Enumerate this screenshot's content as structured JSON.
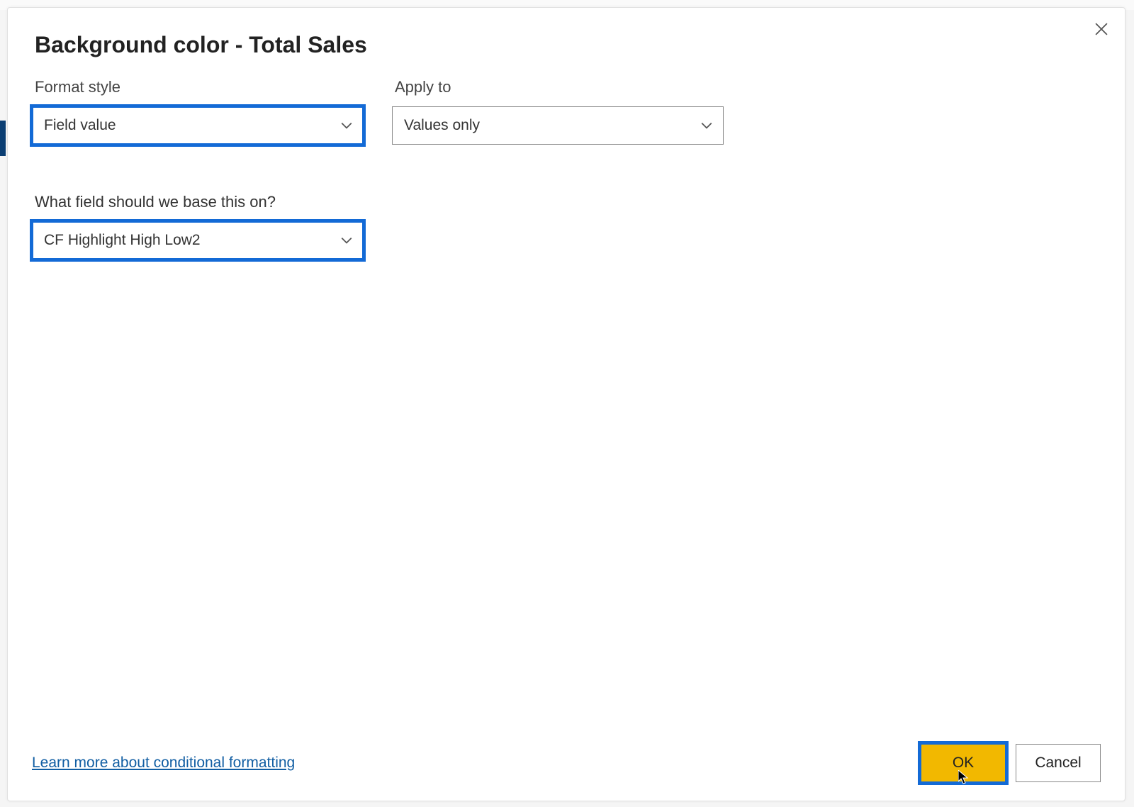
{
  "dialog": {
    "title": "Background color - Total Sales",
    "close_label": "Close"
  },
  "fields": {
    "format_style": {
      "label": "Format style",
      "value": "Field value"
    },
    "apply_to": {
      "label": "Apply to",
      "value": "Values only"
    },
    "base_field": {
      "label": "What field should we base this on?",
      "value": "CF Highlight High Low2"
    }
  },
  "footer": {
    "learn_more": "Learn more about conditional formatting",
    "ok": "OK",
    "cancel": "Cancel"
  },
  "highlight_color": "#136ad6",
  "ok_button_color": "#f2b800"
}
